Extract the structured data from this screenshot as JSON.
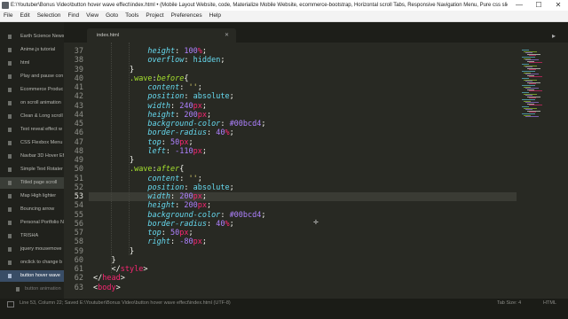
{
  "window": {
    "title": "E:\\Youtuber\\Bonus Video\\button hover wave effect\\index.html • (Mobile Layout Website, code, Materialize Mobile Website, ecommerce-bootstrap, Horizontal scroll Tabs, Responsive Navigation Menu, Pure css sliding navigation bu...",
    "minimize": "—",
    "maximize": "☐",
    "close": "✕"
  },
  "menu": [
    "File",
    "Edit",
    "Selection",
    "Find",
    "View",
    "Goto",
    "Tools",
    "Project",
    "Preferences",
    "Help"
  ],
  "sidebar": {
    "items": [
      {
        "label": "Earth Science News"
      },
      {
        "label": "Anime.js tutorial"
      },
      {
        "label": "html"
      },
      {
        "label": "Play and pause con"
      },
      {
        "label": "Ecommerce Produc"
      },
      {
        "label": "on scroll animation"
      },
      {
        "label": "Clean & Long scroll"
      },
      {
        "label": "Text reveal effect w"
      },
      {
        "label": "CSS Flexbox Menu"
      },
      {
        "label": "Navbar 3D Hover Ef"
      },
      {
        "label": "Simple Text Rotater"
      },
      {
        "label": "Titled page scroll"
      },
      {
        "label": "Map High lighter"
      },
      {
        "label": "Bouncing arrow"
      },
      {
        "label": "Personal Portfolio N"
      },
      {
        "label": "TRISHA"
      },
      {
        "label": "jquery mousemove"
      },
      {
        "label": "onclick to change b"
      },
      {
        "label": "button hover wave"
      },
      {
        "label": "button animation"
      }
    ]
  },
  "tab": {
    "name": "index.html",
    "close": "✕",
    "nav": "▸"
  },
  "editor": {
    "line_numbers": [
      "37",
      "38",
      "39",
      "40",
      "41",
      "42",
      "43",
      "44",
      "45",
      "46",
      "47",
      "48",
      "49",
      "50",
      "51",
      "52",
      "53",
      "54",
      "55",
      "56",
      "57",
      "58",
      "59",
      "60",
      "61",
      "62",
      "63"
    ],
    "current_line": "53",
    "lines": [
      [
        {
          "t": "            "
        },
        {
          "t": "height",
          "c": "prop"
        },
        {
          "t": ": ",
          "c": "plain"
        },
        {
          "t": "100",
          "c": "num"
        },
        {
          "t": "%",
          "c": "unit"
        },
        {
          "t": ";",
          "c": "plain"
        }
      ],
      [
        {
          "t": "            "
        },
        {
          "t": "overflow",
          "c": "prop"
        },
        {
          "t": ": ",
          "c": "plain"
        },
        {
          "t": "hidden",
          "c": "val"
        },
        {
          "t": ";",
          "c": "plain"
        }
      ],
      [
        {
          "t": "        "
        },
        {
          "t": "}",
          "c": "plain"
        }
      ],
      [
        {
          "t": "        "
        },
        {
          "t": ".wave",
          "c": "sel"
        },
        {
          "t": ":",
          "c": "plain"
        },
        {
          "t": "before",
          "c": "pseudo"
        },
        {
          "t": "{",
          "c": "plain"
        }
      ],
      [
        {
          "t": "            "
        },
        {
          "t": "content",
          "c": "prop"
        },
        {
          "t": ": ",
          "c": "plain"
        },
        {
          "t": "''",
          "c": "str"
        },
        {
          "t": ";",
          "c": "plain"
        }
      ],
      [
        {
          "t": "            "
        },
        {
          "t": "position",
          "c": "prop"
        },
        {
          "t": ": ",
          "c": "plain"
        },
        {
          "t": "absolute",
          "c": "val"
        },
        {
          "t": ";",
          "c": "plain"
        }
      ],
      [
        {
          "t": "            "
        },
        {
          "t": "width",
          "c": "prop"
        },
        {
          "t": ": ",
          "c": "plain"
        },
        {
          "t": "240",
          "c": "num"
        },
        {
          "t": "px",
          "c": "unit"
        },
        {
          "t": ";",
          "c": "plain"
        }
      ],
      [
        {
          "t": "            "
        },
        {
          "t": "height",
          "c": "prop"
        },
        {
          "t": ": ",
          "c": "plain"
        },
        {
          "t": "200",
          "c": "num"
        },
        {
          "t": "px",
          "c": "unit"
        },
        {
          "t": ";",
          "c": "plain"
        }
      ],
      [
        {
          "t": "            "
        },
        {
          "t": "background-color",
          "c": "prop"
        },
        {
          "t": ": ",
          "c": "plain"
        },
        {
          "t": "#00bcd4",
          "c": "num"
        },
        {
          "t": ";",
          "c": "plain"
        }
      ],
      [
        {
          "t": "            "
        },
        {
          "t": "border-radius",
          "c": "prop"
        },
        {
          "t": ": ",
          "c": "plain"
        },
        {
          "t": "40",
          "c": "num"
        },
        {
          "t": "%",
          "c": "unit"
        },
        {
          "t": ";",
          "c": "plain"
        }
      ],
      [
        {
          "t": "            "
        },
        {
          "t": "top",
          "c": "prop"
        },
        {
          "t": ": ",
          "c": "plain"
        },
        {
          "t": "50",
          "c": "num"
        },
        {
          "t": "px",
          "c": "unit"
        },
        {
          "t": ";",
          "c": "plain"
        }
      ],
      [
        {
          "t": "            "
        },
        {
          "t": "left",
          "c": "prop"
        },
        {
          "t": ": ",
          "c": "plain"
        },
        {
          "t": "-110",
          "c": "num"
        },
        {
          "t": "px",
          "c": "unit"
        },
        {
          "t": ";",
          "c": "plain"
        }
      ],
      [
        {
          "t": "        "
        },
        {
          "t": "}",
          "c": "plain"
        }
      ],
      [
        {
          "t": "        "
        },
        {
          "t": ".wave",
          "c": "sel"
        },
        {
          "t": ":",
          "c": "plain"
        },
        {
          "t": "after",
          "c": "pseudo"
        },
        {
          "t": "{",
          "c": "plain"
        }
      ],
      [
        {
          "t": "            "
        },
        {
          "t": "content",
          "c": "prop"
        },
        {
          "t": ": ",
          "c": "plain"
        },
        {
          "t": "''",
          "c": "str"
        },
        {
          "t": ";",
          "c": "plain"
        }
      ],
      [
        {
          "t": "            "
        },
        {
          "t": "position",
          "c": "prop"
        },
        {
          "t": ": ",
          "c": "plain"
        },
        {
          "t": "absolute",
          "c": "val"
        },
        {
          "t": ";",
          "c": "plain"
        }
      ],
      [
        {
          "t": "            "
        },
        {
          "t": "width",
          "c": "prop"
        },
        {
          "t": ": ",
          "c": "plain"
        },
        {
          "t": "200",
          "c": "num"
        },
        {
          "t": "px",
          "c": "unit"
        },
        {
          "t": ";",
          "c": "plain"
        }
      ],
      [
        {
          "t": "            "
        },
        {
          "t": "height",
          "c": "prop"
        },
        {
          "t": ": ",
          "c": "plain"
        },
        {
          "t": "200",
          "c": "num"
        },
        {
          "t": "px",
          "c": "unit"
        },
        {
          "t": ";",
          "c": "plain"
        }
      ],
      [
        {
          "t": "            "
        },
        {
          "t": "background-color",
          "c": "prop"
        },
        {
          "t": ": ",
          "c": "plain"
        },
        {
          "t": "#00bcd4",
          "c": "num"
        },
        {
          "t": ";",
          "c": "plain"
        }
      ],
      [
        {
          "t": "            "
        },
        {
          "t": "border-radius",
          "c": "prop"
        },
        {
          "t": ": ",
          "c": "plain"
        },
        {
          "t": "40",
          "c": "num"
        },
        {
          "t": "%",
          "c": "unit"
        },
        {
          "t": ";",
          "c": "plain"
        }
      ],
      [
        {
          "t": "            "
        },
        {
          "t": "top",
          "c": "prop"
        },
        {
          "t": ": ",
          "c": "plain"
        },
        {
          "t": "50",
          "c": "num"
        },
        {
          "t": "px",
          "c": "unit"
        },
        {
          "t": ";",
          "c": "plain"
        }
      ],
      [
        {
          "t": "            "
        },
        {
          "t": "right",
          "c": "prop"
        },
        {
          "t": ": ",
          "c": "plain"
        },
        {
          "t": "-80",
          "c": "num"
        },
        {
          "t": "px",
          "c": "unit"
        },
        {
          "t": ";",
          "c": "plain"
        }
      ],
      [
        {
          "t": "        "
        },
        {
          "t": "}",
          "c": "plain"
        }
      ],
      [
        {
          "t": "    "
        },
        {
          "t": "}",
          "c": "plain"
        }
      ],
      [
        {
          "t": "    "
        },
        {
          "t": "</",
          "c": "plain"
        },
        {
          "t": "style",
          "c": "tag"
        },
        {
          "t": ">",
          "c": "plain"
        }
      ],
      [
        {
          "t": "</",
          "c": "plain"
        },
        {
          "t": "head",
          "c": "tag"
        },
        {
          "t": ">",
          "c": "plain"
        }
      ],
      [
        {
          "t": "<",
          "c": "plain"
        },
        {
          "t": "body",
          "c": "tag"
        },
        {
          "t": ">",
          "c": "plain"
        }
      ]
    ]
  },
  "colors": {
    "prop": "#66d9ef",
    "val": "#66d9ef",
    "num": "#ae81ff",
    "unit": "#f92672",
    "sel": "#a6e22e",
    "pseudo": "#a6e22e",
    "str": "#e6db74",
    "tag": "#f92672",
    "plain": "#f8f8f2"
  },
  "status": {
    "left": "Line 53, Column 22; Saved E:\\Youtuber\\Bonus Video\\button hover wave effect\\index.html (UTF-8)",
    "tab_size": "Tab Size: 4",
    "syntax": "HTML"
  }
}
